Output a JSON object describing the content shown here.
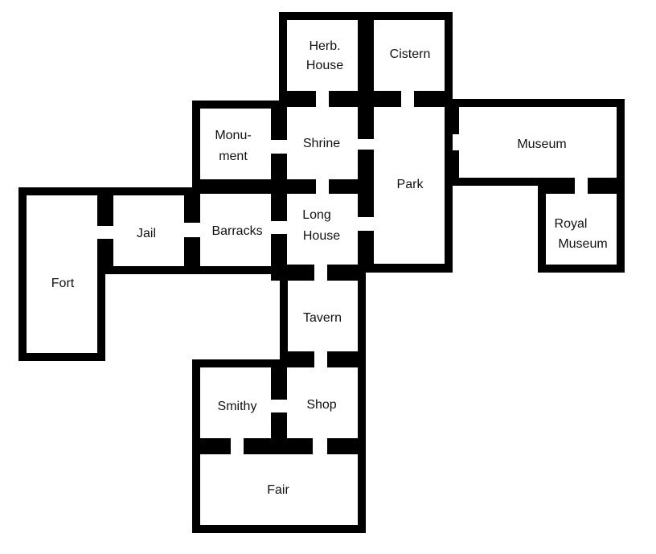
{
  "colors": {
    "wall": "#000000",
    "floor": "#ffffff",
    "text": "#111111"
  },
  "rooms": {
    "herb_house": [
      "Herb.",
      "House"
    ],
    "cistern": [
      "Cistern"
    ],
    "monument": [
      "Monu-",
      "ment"
    ],
    "shrine": [
      "Shrine"
    ],
    "museum": [
      "Museum"
    ],
    "park": [
      "Park"
    ],
    "jail": [
      "Jail"
    ],
    "barracks": [
      "Barracks"
    ],
    "long_house": [
      "Long",
      "House"
    ],
    "royal_museum": [
      "Royal",
      "Museum"
    ],
    "fort": [
      "Fort"
    ],
    "tavern": [
      "Tavern"
    ],
    "smithy": [
      "Smithy"
    ],
    "shop": [
      "Shop"
    ],
    "fair": [
      "Fair"
    ]
  }
}
